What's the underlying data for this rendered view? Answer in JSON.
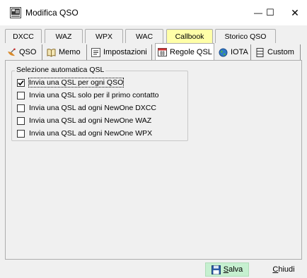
{
  "window": {
    "title": "Modifica QSO",
    "min_glyph": "—",
    "max_glyph": "☐",
    "close_glyph": "✕"
  },
  "tabs_top": [
    {
      "label": "DXCC",
      "active": false
    },
    {
      "label": "WAZ",
      "active": false
    },
    {
      "label": "WPX",
      "active": false
    },
    {
      "label": "WAC",
      "active": false
    },
    {
      "label": "Callbook",
      "active": true
    },
    {
      "label": "Storico QSO",
      "active": false
    }
  ],
  "tabs_bottom": [
    {
      "label": "QSO",
      "icon": "satellite-dish-icon",
      "active": false
    },
    {
      "label": "Memo",
      "icon": "notes-icon",
      "active": false
    },
    {
      "label": "Impostazioni",
      "icon": "settings-list-icon",
      "active": false
    },
    {
      "label": "Regole QSL",
      "icon": "calendar-icon",
      "active": true
    },
    {
      "label": "IOTA",
      "icon": "globe-icon",
      "active": false
    },
    {
      "label": "Custom",
      "icon": "grid-icon",
      "active": false
    }
  ],
  "group": {
    "title": "Selezione automatica QSL",
    "options": [
      {
        "label": "Invia una QSL per ogni QSO",
        "checked": true
      },
      {
        "label": "Invia una QSL solo per il primo contatto",
        "checked": false
      },
      {
        "label": "Invia una QSL ad ogni NewOne DXCC",
        "checked": false
      },
      {
        "label": "Invia una QSL ad ogni NewOne WAZ",
        "checked": false
      },
      {
        "label": "Invia una QSL ad ogni NewOne WPX",
        "checked": false
      }
    ]
  },
  "buttons": {
    "save_accel": "S",
    "save_rest": "alva",
    "close_accel": "C",
    "close_rest": "hiudi"
  },
  "colors": {
    "active_tab": "#ffffa8",
    "save_button": "#c6f0d0"
  }
}
